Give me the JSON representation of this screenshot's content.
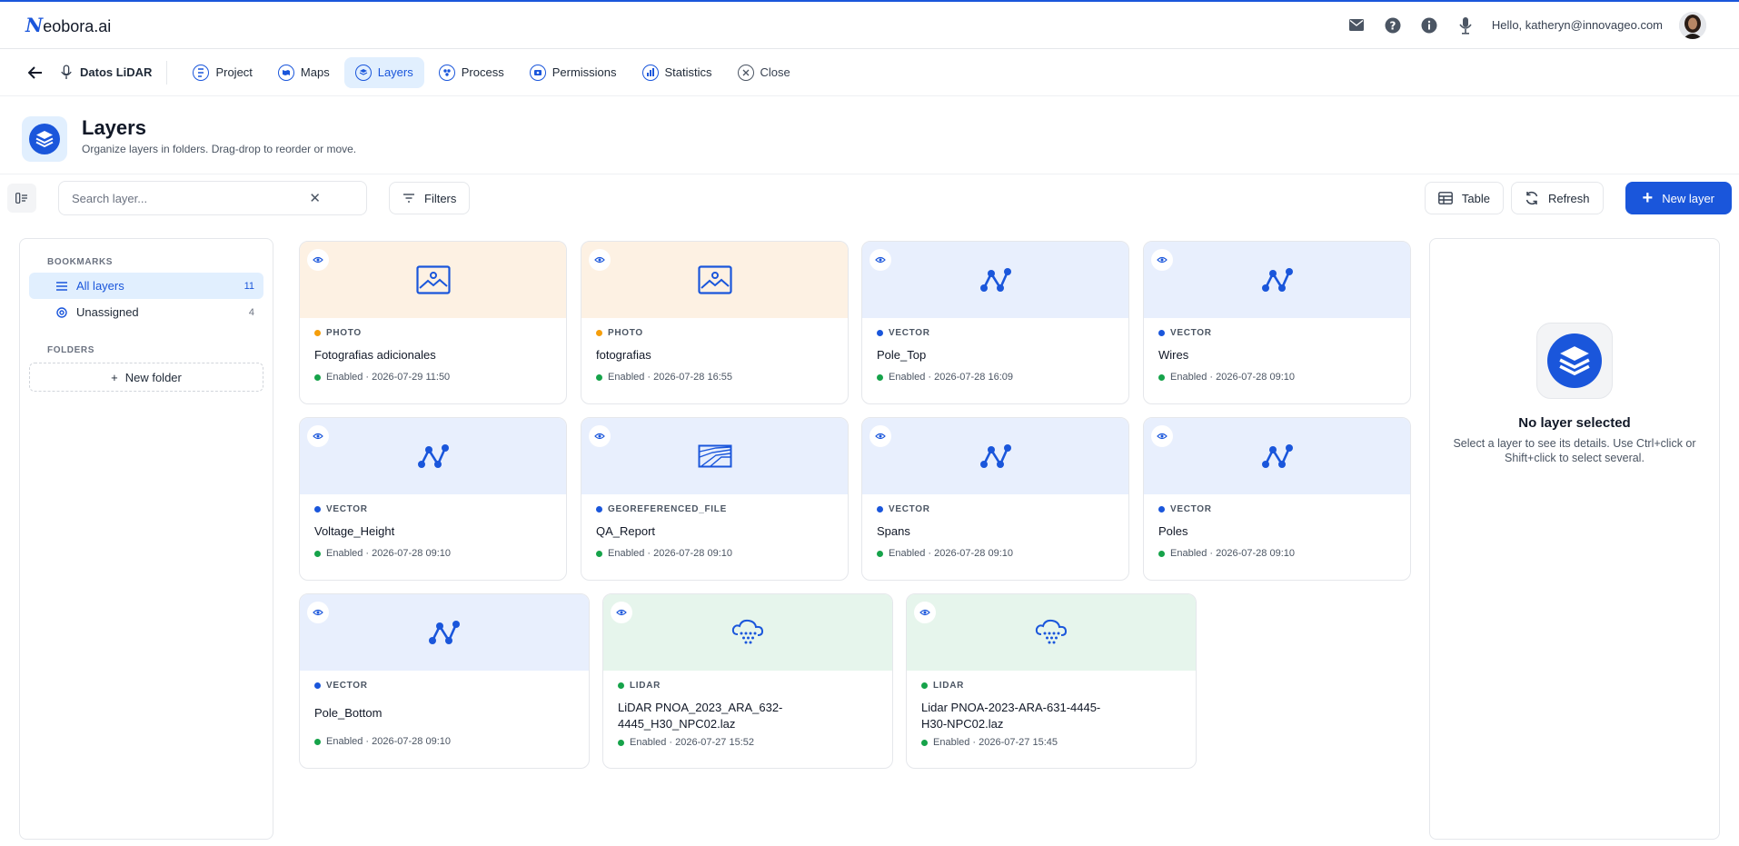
{
  "app": {
    "logo_mark": "N",
    "logo_text": "eobora.ai"
  },
  "header": {
    "user_greeting": "Hello, katheryn@innovageo.com",
    "icons": [
      "mail-icon",
      "help-icon",
      "info-icon",
      "microphone-icon"
    ]
  },
  "nav": {
    "project_name": "Datos LiDAR",
    "tabs": [
      {
        "label": "Project",
        "icon": "project-icon"
      },
      {
        "label": "Maps",
        "icon": "maps-icon"
      },
      {
        "label": "Layers",
        "icon": "layers-icon",
        "active": true
      },
      {
        "label": "Process",
        "icon": "process-icon"
      },
      {
        "label": "Permissions",
        "icon": "permissions-icon"
      },
      {
        "label": "Statistics",
        "icon": "statistics-icon"
      },
      {
        "label": "Close",
        "icon": "close-icon"
      }
    ]
  },
  "page": {
    "title": "Layers",
    "subtitle": "Organize layers in folders. Drag-drop to reorder or move."
  },
  "toolbar": {
    "search_placeholder": "Search layer...",
    "search_value": "",
    "clear_symbol": "✕",
    "filters_label": "Filters",
    "table_label": "Table",
    "refresh_label": "Refresh",
    "new_layer_label": "New layer"
  },
  "sidebar": {
    "bookmarks_heading": "BOOKMARKS",
    "items": [
      {
        "label": "All layers",
        "count": "11",
        "active": true
      },
      {
        "label": "Unassigned",
        "count": "4"
      }
    ],
    "folders_heading": "FOLDERS",
    "new_folder_label": "New folder"
  },
  "colors": {
    "accent": "#1a56db",
    "photo_dot": "#f59e0b",
    "vector_dot": "#1a56db",
    "lidar_dot": "#16a34a",
    "enabled_dot": "#16a34a",
    "photo_bg": "#fdf1e3",
    "vector_bg": "#e8effd",
    "lidar_bg": "#e6f5ec"
  },
  "layers": [
    {
      "type": "PHOTO",
      "name": "Fotografias adicionales",
      "status": "Enabled · 2026-07-29 11:50",
      "icon": "image-icon"
    },
    {
      "type": "PHOTO",
      "name": "fotografias",
      "status": "Enabled · 2026-07-28 16:55",
      "icon": "image-icon"
    },
    {
      "type": "VECTOR",
      "name": "Pole_Top",
      "status": "Enabled · 2026-07-28 16:09",
      "icon": "vector-icon"
    },
    {
      "type": "VECTOR",
      "name": "Wires",
      "status": "Enabled · 2026-07-28 09:10",
      "icon": "vector-icon"
    },
    {
      "type": "VECTOR",
      "name": "Voltage_Height",
      "status": "Enabled · 2026-07-28 09:10",
      "icon": "vector-icon"
    },
    {
      "type": "GEOREFERENCED_FILE",
      "name": "QA_Report",
      "status": "Enabled · 2026-07-28 09:10",
      "icon": "georeferenced-map-icon"
    },
    {
      "type": "VECTOR",
      "name": "Spans",
      "status": "Enabled · 2026-07-28 09:10",
      "icon": "vector-icon"
    },
    {
      "type": "VECTOR",
      "name": "Poles",
      "status": "Enabled · 2026-07-28 09:10",
      "icon": "vector-icon"
    },
    {
      "type": "VECTOR",
      "name": "Pole_Bottom",
      "status": "Enabled · 2026-07-28 09:10",
      "icon": "vector-icon"
    },
    {
      "type": "LIDAR",
      "name": "LiDAR PNOA_2023_ARA_632-4445_H30_NPC02.laz",
      "status": "Enabled · 2026-07-27 15:52",
      "icon": "point-cloud-icon"
    },
    {
      "type": "LIDAR",
      "name": "Lidar PNOA-2023-ARA-631-4445-H30-NPC02.laz",
      "status": "Enabled · 2026-07-27 15:45",
      "icon": "point-cloud-icon"
    }
  ],
  "detail": {
    "title": "No layer selected",
    "text": "Select a layer to see its details. Use Ctrl+click or Shift+click to select several."
  }
}
